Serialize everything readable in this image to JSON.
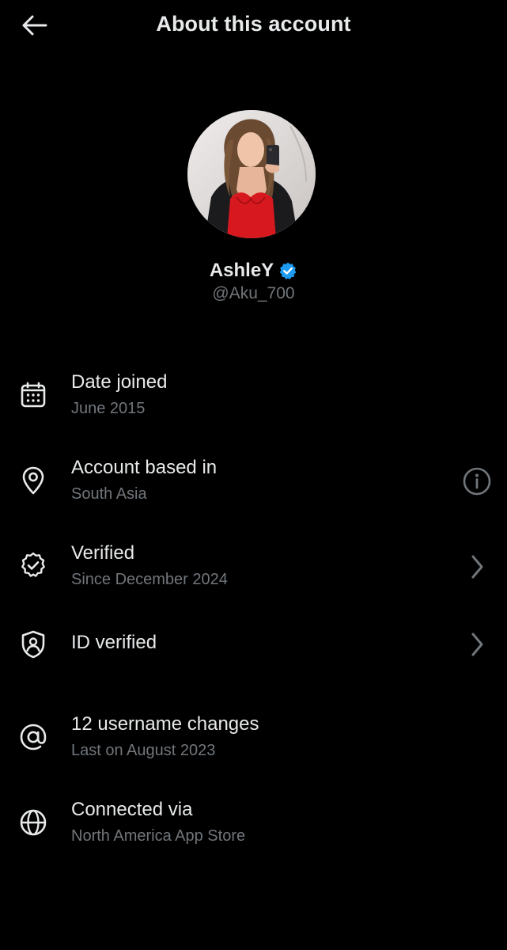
{
  "header": {
    "back_icon": "arrow-left-icon",
    "title": "About this account"
  },
  "profile": {
    "name": "AshleY",
    "handle": "@Aku_700",
    "verified": true,
    "badge_color": "#1d9bf0"
  },
  "rows": [
    {
      "icon": "calendar-icon",
      "title": "Date joined",
      "subtitle": "June 2015",
      "action": null
    },
    {
      "icon": "location-pin-icon",
      "title": "Account based in",
      "subtitle": "South Asia",
      "action": "info-icon"
    },
    {
      "icon": "verified-check-icon",
      "title": "Verified",
      "subtitle": "Since December 2024",
      "action": "chevron-right-icon"
    },
    {
      "icon": "id-shield-icon",
      "title": "ID verified",
      "subtitle": "",
      "action": "chevron-right-icon"
    },
    {
      "icon": "at-sign-icon",
      "title": "12 username changes",
      "subtitle": "Last on August 2023",
      "action": null
    },
    {
      "icon": "globe-icon",
      "title": "Connected via",
      "subtitle": "North America App Store",
      "action": null
    }
  ],
  "colors": {
    "background": "#000000",
    "primary_text": "#e7e9ea",
    "secondary_text": "#71767b",
    "accent": "#1d9bf0"
  }
}
